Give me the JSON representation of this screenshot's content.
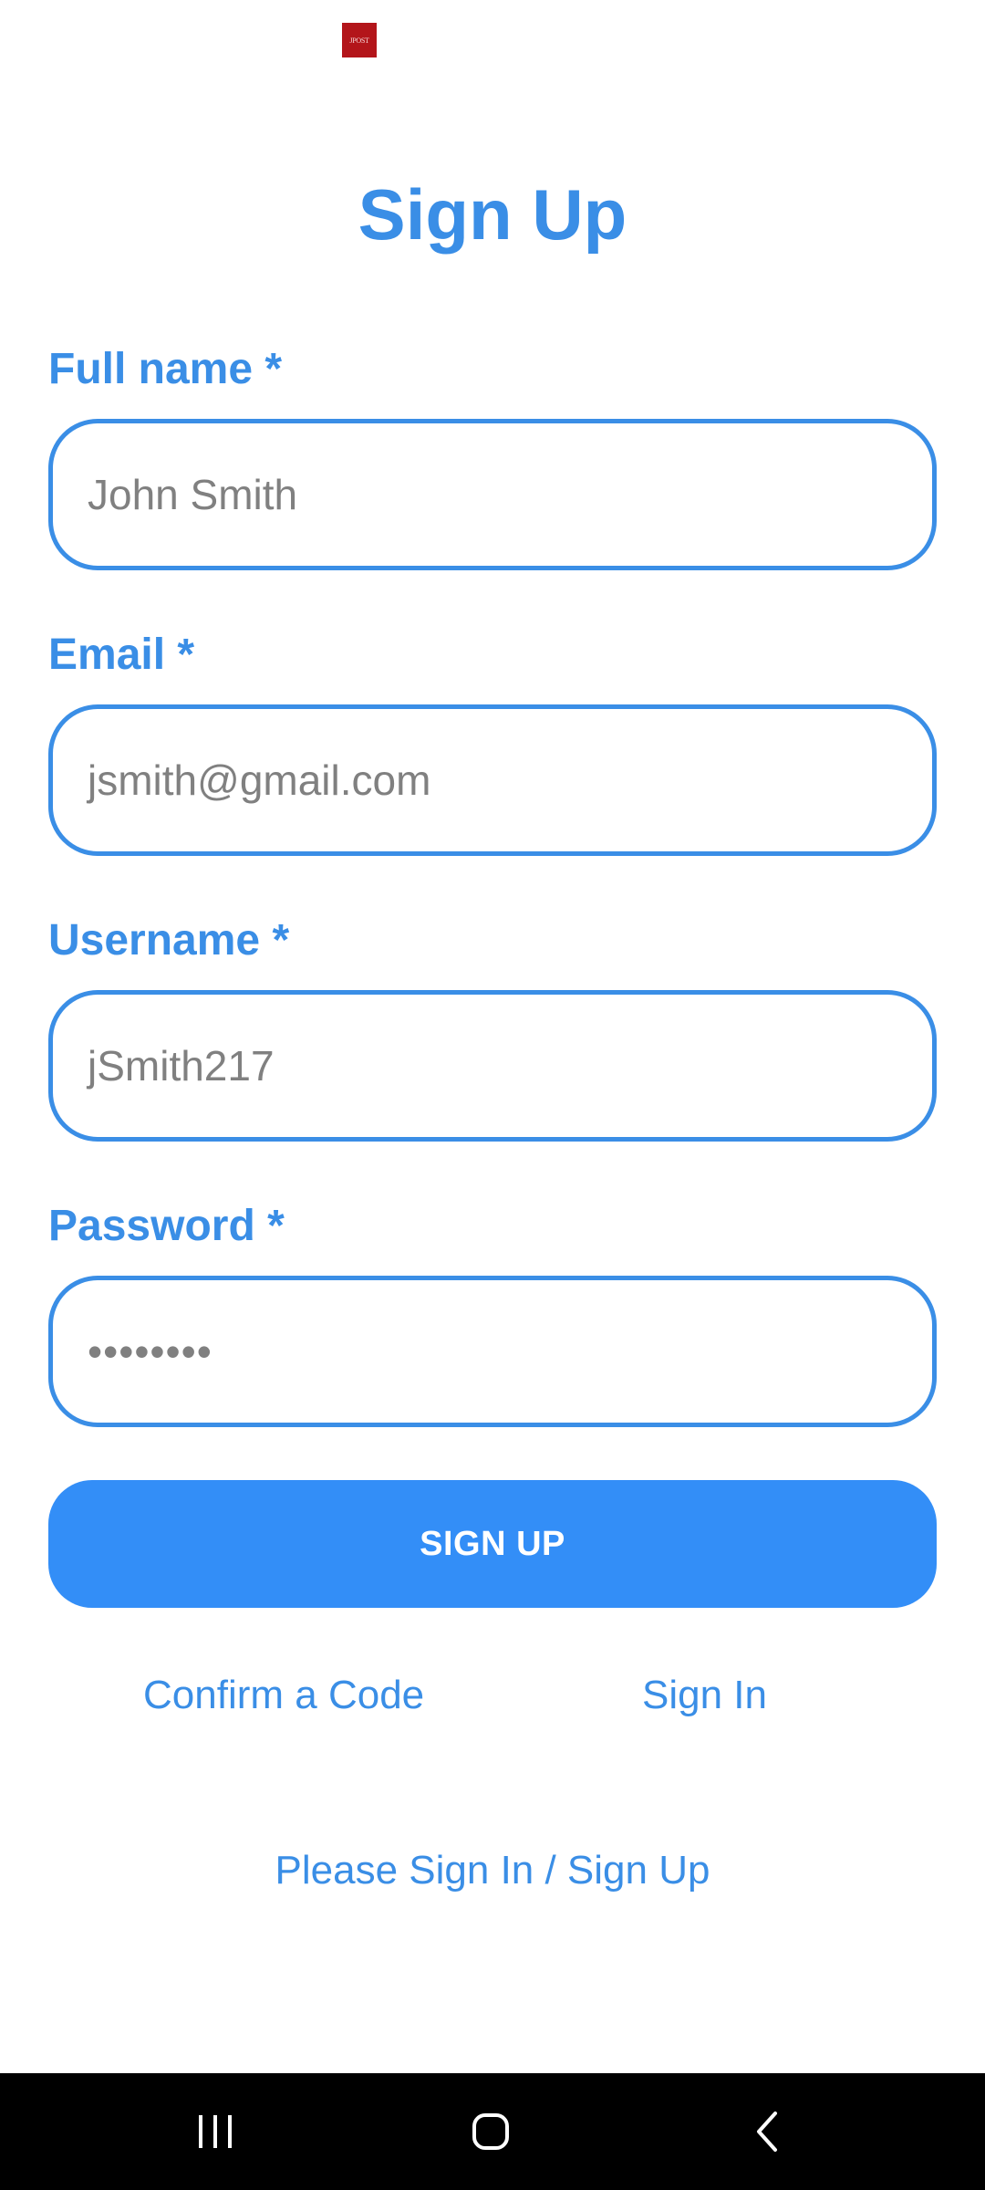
{
  "header": {
    "logo_text": "JPOST"
  },
  "title": "Sign Up",
  "form": {
    "full_name": {
      "label": "Full name *",
      "value": "John Smith"
    },
    "email": {
      "label": "Email *",
      "value": "jsmith@gmail.com"
    },
    "username": {
      "label": "Username *",
      "value": "jSmith217"
    },
    "password": {
      "label": "Password *",
      "value": "••••••••"
    }
  },
  "buttons": {
    "sign_up": "SIGN UP"
  },
  "links": {
    "confirm_code": "Confirm a Code",
    "sign_in": "Sign In",
    "prompt": "Please Sign In / Sign Up"
  },
  "nav": {
    "recent_icon": "recent-apps-icon",
    "home_icon": "home-icon",
    "back_icon": "back-icon"
  },
  "colors": {
    "accent": "#3a8ee6",
    "button": "#338ef7",
    "input_text": "#808080",
    "logo": "#b3151a",
    "navbar": "#000000"
  }
}
